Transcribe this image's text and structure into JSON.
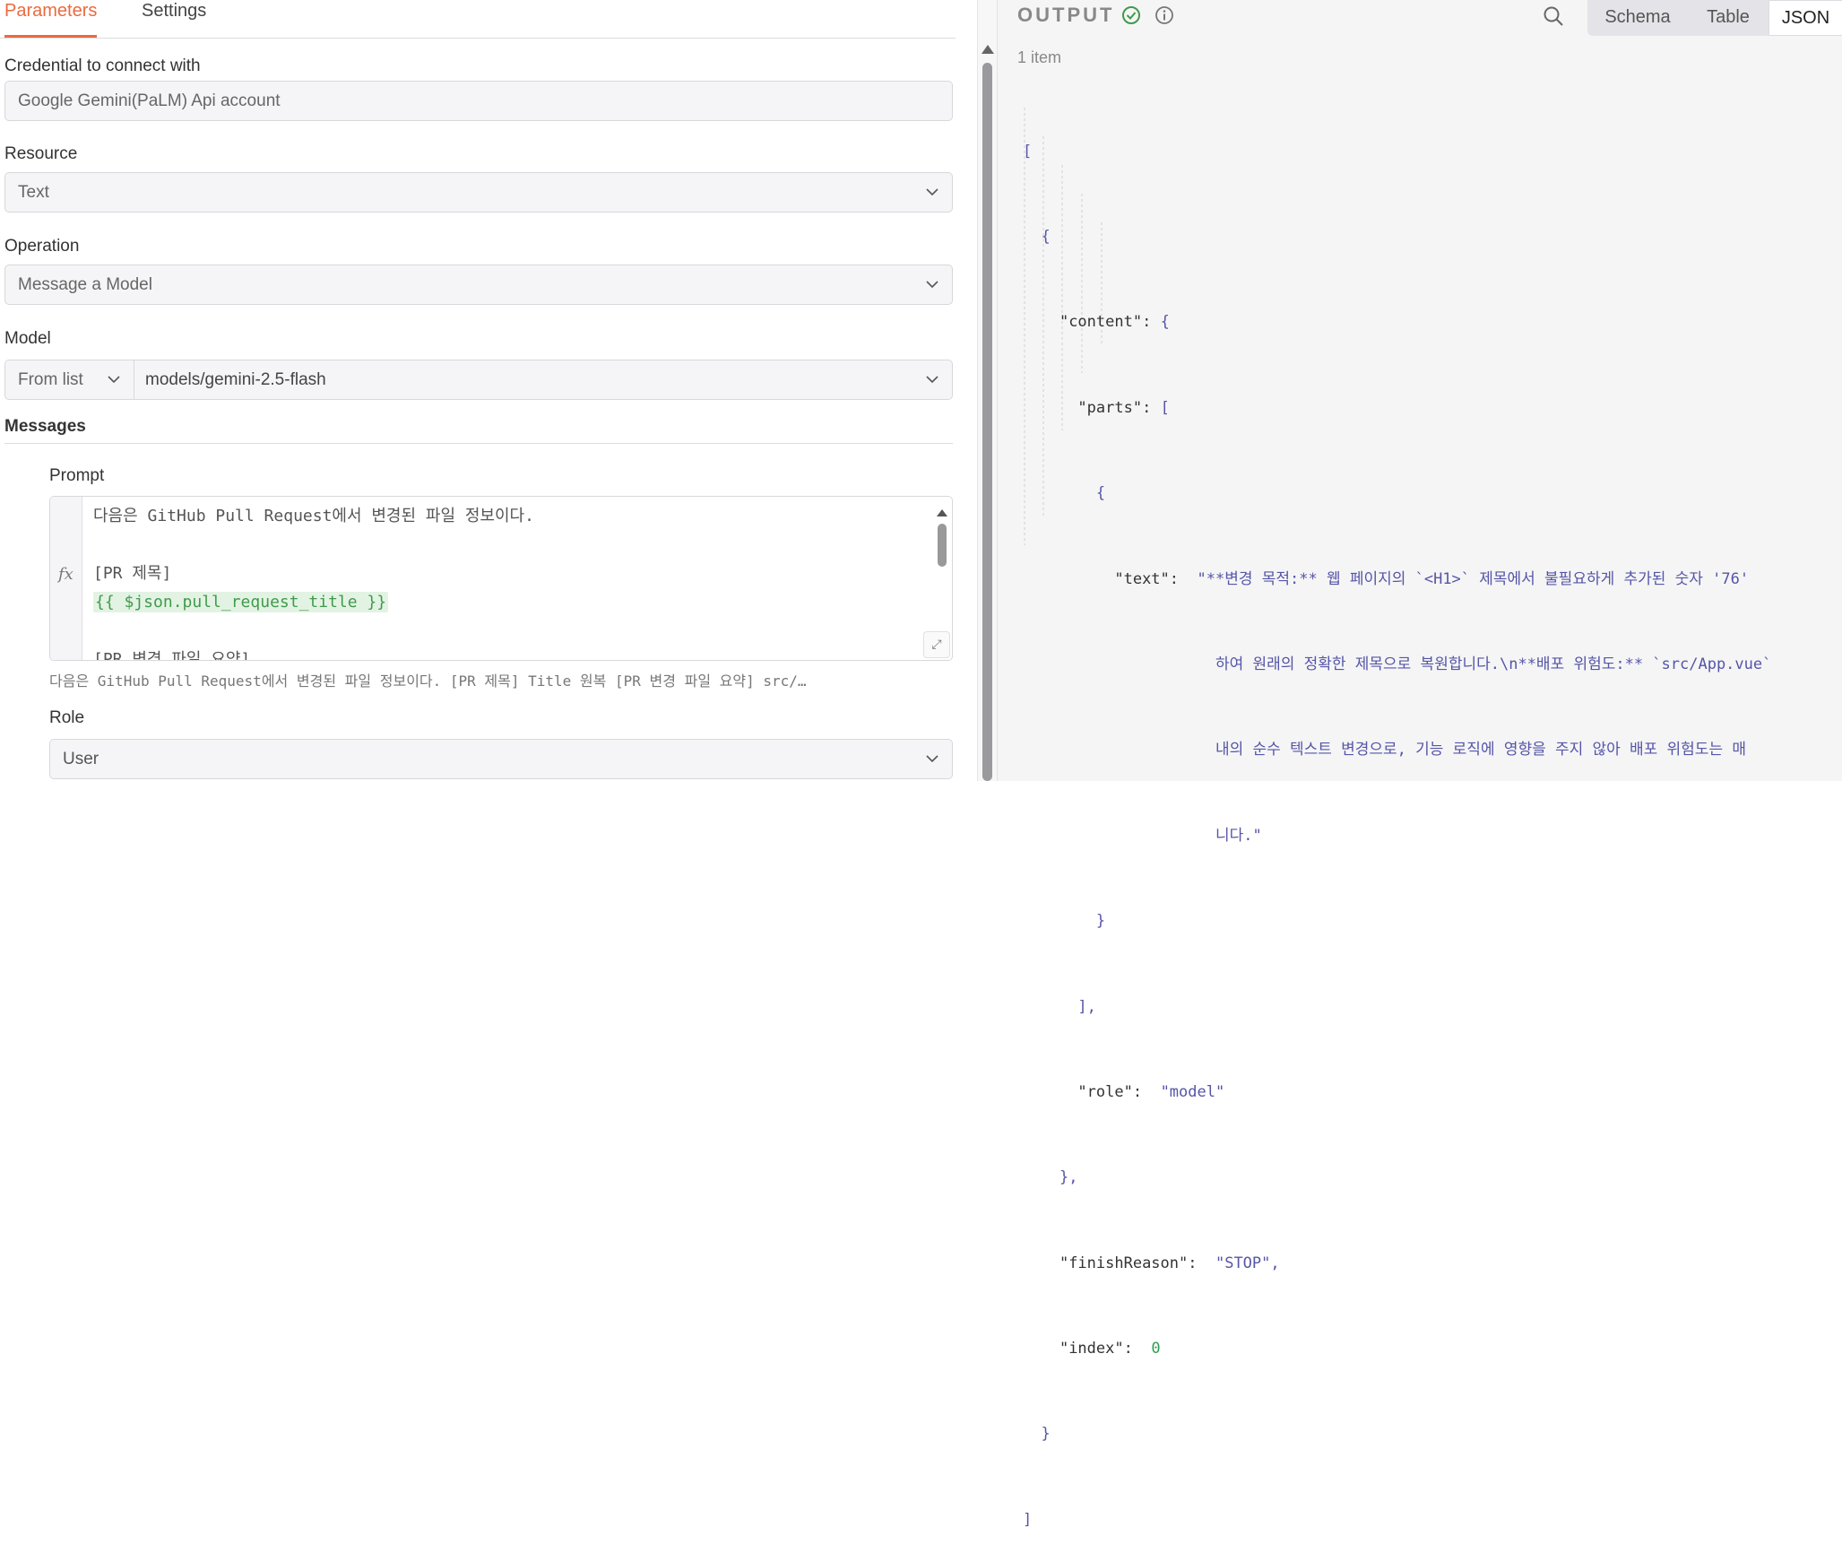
{
  "tabs": {
    "parameters": "Parameters",
    "settings": "Settings"
  },
  "credential": {
    "label": "Credential to connect with",
    "value": "Google Gemini(PaLM) Api account"
  },
  "resource": {
    "label": "Resource",
    "value": "Text"
  },
  "operation": {
    "label": "Operation",
    "value": "Message a Model"
  },
  "model": {
    "label": "Model",
    "source": "From list",
    "value": "models/gemini-2.5-flash"
  },
  "messages": {
    "label": "Messages"
  },
  "prompt": {
    "label": "Prompt",
    "fx": "fx",
    "line1": "다음은 GitHub Pull Request에서 변경된 파일 정보이다.",
    "line2": "[PR 제목]",
    "line3": "{{ $json.pull_request_title }}",
    "line4": "[PR 변경 파일 요약]",
    "preview": "다음은 GitHub Pull Request에서 변경된 파일 정보이다. [PR 제목] Title 원복 [PR 변경 파일 요약] src/…"
  },
  "role": {
    "label": "Role",
    "value": "User"
  },
  "output": {
    "title": "OUTPUT",
    "views": {
      "schema": "Schema",
      "table": "Table",
      "json": "JSON"
    },
    "count": "1 item",
    "json": {
      "text_key": "\"text\"",
      "text_l1": "\"**변경 목적:** 웹 페이지의 `<H1>` 제목에서 불필요하게 추가된 숫자 '76'",
      "text_l2": "하여 원래의 정확한 제목으로 복원합니다.\\n**배포 위험도:** `src/App.vue`",
      "text_l3": "내의 순수 텍스트 변경으로, 기능 로직에 영향을 주지 않아 배포 위험도는 매",
      "text_l4": "니다.\"",
      "content_key": "\"content\"",
      "parts_key": "\"parts\"",
      "role_key": "\"role\"",
      "role_val": "\"model\"",
      "finish_key": "\"finishReason\"",
      "finish_val": "\"STOP\"",
      "index_key": "\"index\"",
      "index_val": "0"
    }
  },
  "colors": {
    "accent": "#ea6a3f",
    "success": "#3f9b4c",
    "json_string": "#5555a8",
    "json_number": "#2e9d55"
  },
  "icons": [
    "chevron-down-icon",
    "fx-icon",
    "expand-icon",
    "check-circle-icon",
    "info-icon",
    "search-icon"
  ]
}
